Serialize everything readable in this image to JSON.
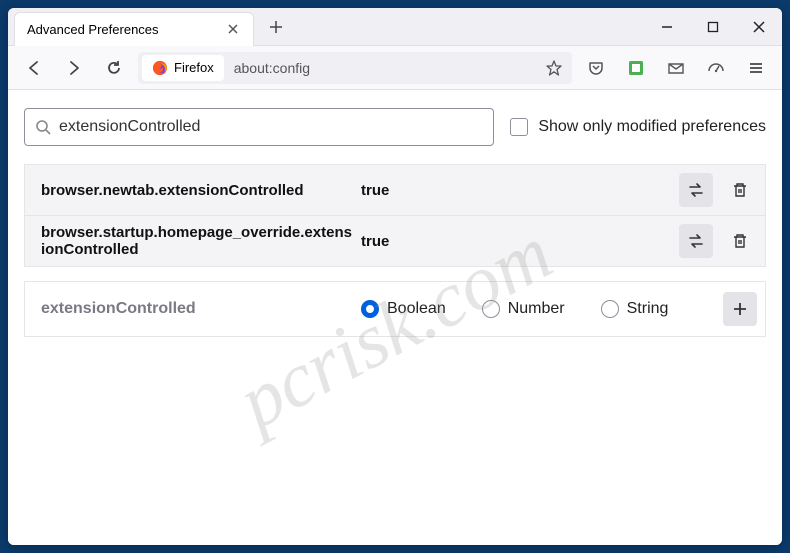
{
  "window": {
    "tab_title": "Advanced Preferences"
  },
  "urlbar": {
    "identity_label": "Firefox",
    "url": "about:config"
  },
  "search": {
    "value": "extensionControlled",
    "checkbox_label": "Show only modified preferences"
  },
  "prefs": [
    {
      "name": "browser.newtab.extensionControlled",
      "value": "true"
    },
    {
      "name": "browser.startup.homepage_override.extensionControlled",
      "value": "true"
    }
  ],
  "new_pref": {
    "name": "extensionControlled",
    "types": {
      "boolean": "Boolean",
      "number": "Number",
      "string": "String"
    }
  },
  "watermark": "pcrisk.com"
}
